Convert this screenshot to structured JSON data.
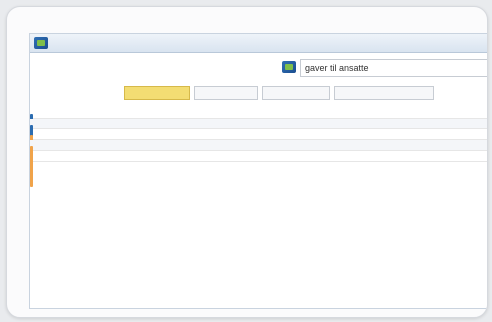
{
  "window": {
    "title": ""
  },
  "search": {
    "value": "gaver til ansatte"
  },
  "tabs": [
    {
      "label": "",
      "active": true
    },
    {
      "label": "",
      "active": false
    },
    {
      "label": "",
      "active": false
    },
    {
      "label": "",
      "active": false
    }
  ],
  "results": [
    {
      "title": "",
      "subtitle": "",
      "meta": ""
    },
    {
      "title": "",
      "subtitle": "",
      "meta": ""
    },
    {
      "title": "",
      "subtitle": "",
      "meta": ""
    },
    {
      "title": "",
      "subtitle": "",
      "meta": ""
    },
    {
      "title": "",
      "subtitle": "",
      "meta": ""
    }
  ],
  "colors": {
    "accent": "#2b6cb0",
    "tab_active": "#f3dd73",
    "gold_title": "#b06a19",
    "marker_orange": "#f0a34a"
  },
  "icons": {
    "app": "app-logo-icon",
    "search": "search-logo-icon"
  }
}
